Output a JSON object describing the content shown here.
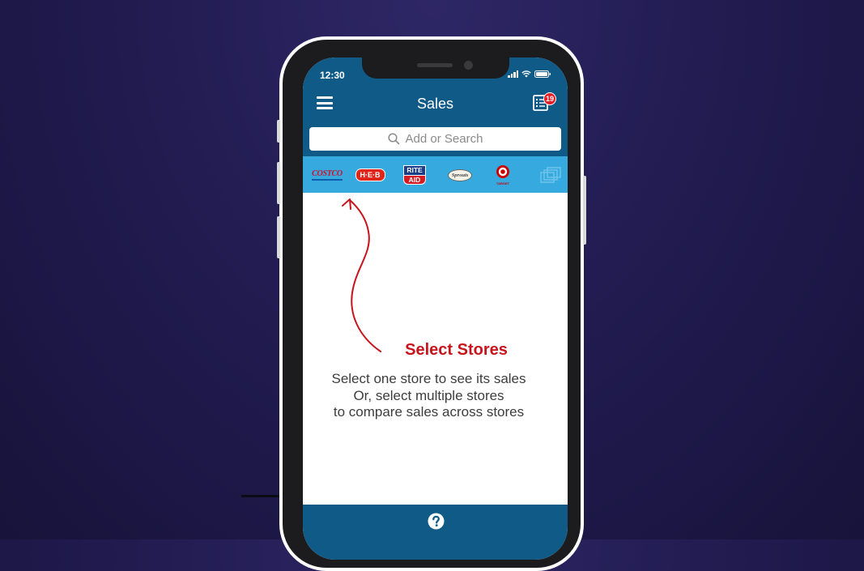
{
  "status_bar": {
    "time": "12:30"
  },
  "header": {
    "title": "Sales",
    "list_badge_count": "19"
  },
  "search": {
    "placeholder": "Add or Search"
  },
  "stores": [
    {
      "name": "Costco",
      "logo_text": "COSTCO"
    },
    {
      "name": "H-E-B",
      "logo_text": "H·E·B"
    },
    {
      "name": "Rite Aid",
      "logo_text_top": "RITE",
      "logo_text_bottom": "AID"
    },
    {
      "name": "Sprouts",
      "logo_text": "Sprouts"
    },
    {
      "name": "Target",
      "logo_text": "TARGET"
    }
  ],
  "empty_state": {
    "title": "Select Stores",
    "line1": "Select one store to see its sales",
    "line2": "Or, select multiple stores",
    "line3": "to compare sales across stores"
  },
  "colors": {
    "header": "#0f5a87",
    "store_bar": "#36a9df",
    "accent_red": "#c8151d",
    "badge": "#e41e26"
  },
  "icons": [
    "hamburger-menu-icon",
    "shopping-list-icon",
    "search-icon",
    "stores-overflow-icon",
    "help-icon",
    "arrow-annotation-icon"
  ]
}
